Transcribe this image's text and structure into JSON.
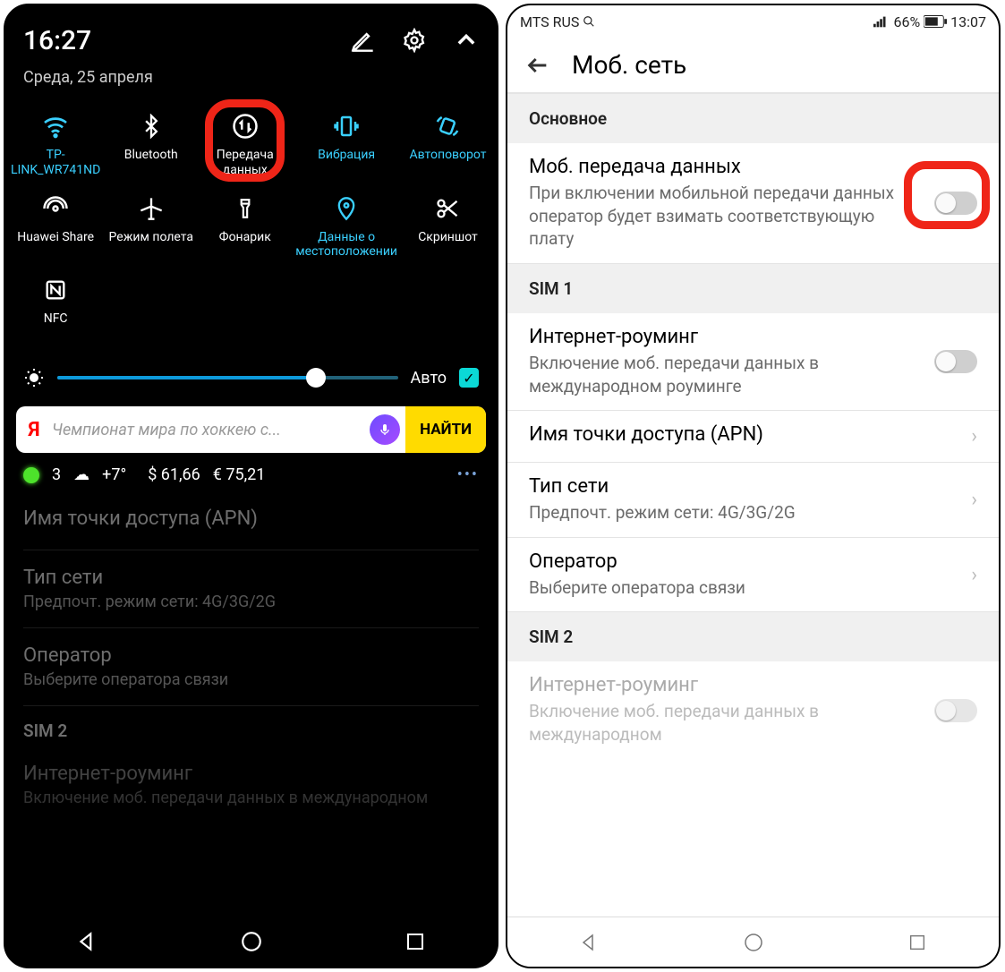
{
  "left": {
    "time": "16:27",
    "date": "Среда, 25 апреля",
    "tiles": [
      {
        "label": "TP-LINK_WR741ND",
        "icon": "wifi",
        "active": true
      },
      {
        "label": "Bluetooth",
        "icon": "bluetooth",
        "active": false
      },
      {
        "label": "Передача данных",
        "icon": "data",
        "active": false,
        "highlight": true
      },
      {
        "label": "Вибрация",
        "icon": "vibrate",
        "active": true
      },
      {
        "label": "Автоповорот",
        "icon": "rotate",
        "active": true
      },
      {
        "label": "Huawei Share",
        "icon": "share",
        "active": false
      },
      {
        "label": "Режим полета",
        "icon": "plane",
        "active": false
      },
      {
        "label": "Фонарик",
        "icon": "torch",
        "active": false
      },
      {
        "label": "Данные о местоположении",
        "icon": "location",
        "active": true
      },
      {
        "label": "Скриншот",
        "icon": "screenshot",
        "active": false
      },
      {
        "label": "NFC",
        "icon": "nfc",
        "active": false
      }
    ],
    "brightness": {
      "auto_label": "Авто"
    },
    "yandex": {
      "placeholder": "Чемпионат мира по хоккею с...",
      "find": "НАЙТИ"
    },
    "info": {
      "notif": "3",
      "weather": "+7°",
      "usd": "$ 61,66",
      "eur": "€ 75,21"
    },
    "dim": {
      "apn": "Имя точки доступа (APN)",
      "net_title": "Тип сети",
      "net_sub": "Предпочт. режим сети: 4G/3G/2G",
      "op_title": "Оператор",
      "op_sub": "Выберите оператора связи",
      "sim2": "SIM 2",
      "roam_title": "Интернет-роуминг",
      "roam_sub": "Включение моб. передачи данных в международном"
    }
  },
  "right": {
    "carrier": "MTS RUS",
    "battery": "66%",
    "clock": "13:07",
    "title": "Моб. сеть",
    "section_main": "Основное",
    "mobile_data": {
      "title": "Моб. передача данных",
      "sub": "При включении мобильной передачи данных оператор будет взимать соответствующую плату"
    },
    "section_sim1": "SIM 1",
    "roaming": {
      "title": "Интернет-роуминг",
      "sub": "Включение моб. передачи данных в международном роуминге"
    },
    "apn": {
      "title": "Имя точки доступа (APN)"
    },
    "net": {
      "title": "Тип сети",
      "sub": "Предпочт. режим сети: 4G/3G/2G"
    },
    "operator": {
      "title": "Оператор",
      "sub": "Выберите оператора связи"
    },
    "section_sim2": "SIM 2",
    "roaming2": {
      "title": "Интернет-роуминг",
      "sub": "Включение моб. передачи данных в международном"
    }
  }
}
